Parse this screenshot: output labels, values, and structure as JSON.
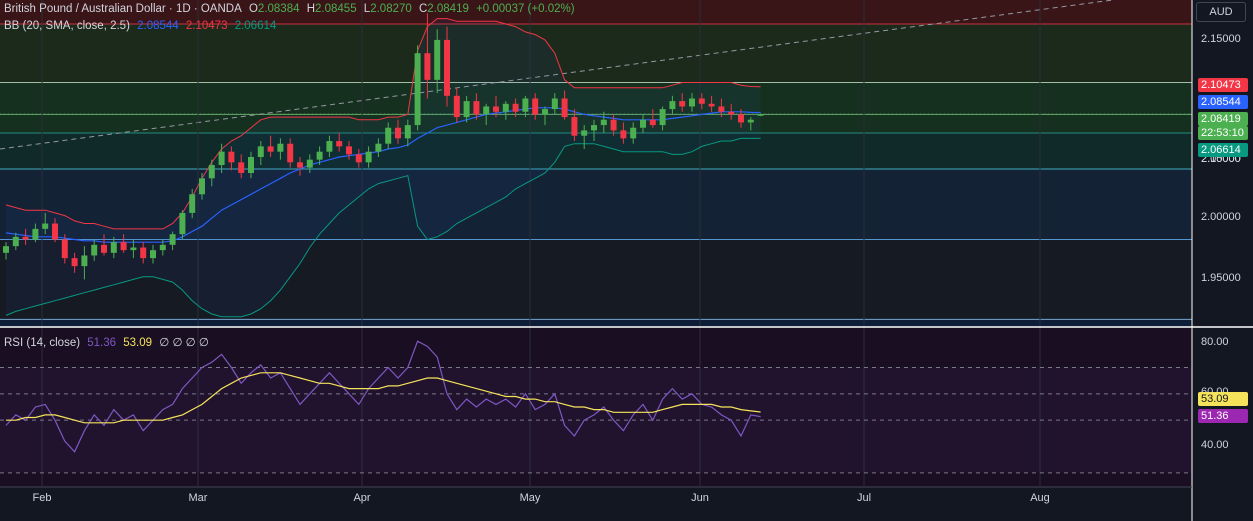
{
  "header": {
    "symbol": "British Pound / Australian Dollar · 1D · OANDA",
    "o_label": "O",
    "o": "2.08384",
    "h_label": "H",
    "h": "2.08455",
    "l_label": "L",
    "l": "2.08270",
    "c_label": "C",
    "c": "2.08419",
    "change": "+0.00037 (+0.02%)",
    "currency": "AUD"
  },
  "bb_legend": {
    "label": "BB (20, SMA, close, 2.5)",
    "basis": "2.08544",
    "upper": "2.10473",
    "lower": "2.06614"
  },
  "rsi_legend": {
    "label": "RSI (14, close)",
    "rsi": "51.36",
    "ma": "53.09",
    "extra": "∅ ∅ ∅ ∅"
  },
  "price_axis": [
    "2.15000",
    "2.10000",
    "2.05000",
    "2.00000",
    "1.95000"
  ],
  "rsi_axis": [
    "80.00",
    "60.00",
    "40.00"
  ],
  "tags": {
    "upper": "2.10473",
    "basis": "2.08544",
    "close": "2.08419",
    "countdown": "22:53:10",
    "lower": "2.06614",
    "rsi_ma": "53.09",
    "rsi": "51.36"
  },
  "months": [
    "Feb",
    "Mar",
    "Apr",
    "May",
    "Jun",
    "Jul",
    "Aug"
  ],
  "colors": {
    "up": "#4caf50",
    "down": "#f23645",
    "upper_band": "#f23645",
    "basis": "#2962ff",
    "lower_band": "#089981",
    "rsi": "#7e57c2",
    "rsi_ma": "#f5e35b",
    "close_tag": "#4caf50"
  },
  "chart_data": {
    "type": "candlestick",
    "price_ylim": [
      1.925,
      2.17
    ],
    "rsi_ylim": [
      25,
      85
    ],
    "candles": [
      [
        1.98,
        1.988,
        1.975,
        1.985
      ],
      [
        1.985,
        1.995,
        1.982,
        1.992
      ],
      [
        1.992,
        1.998,
        1.986,
        1.99
      ],
      [
        1.99,
        2.002,
        1.988,
        1.998
      ],
      [
        1.998,
        2.01,
        1.994,
        2.002
      ],
      [
        2.002,
        2.006,
        1.988,
        1.99
      ],
      [
        1.99,
        1.994,
        1.972,
        1.976
      ],
      [
        1.976,
        1.98,
        1.965,
        1.97
      ],
      [
        1.97,
        1.985,
        1.96,
        1.978
      ],
      [
        1.978,
        1.99,
        1.974,
        1.986
      ],
      [
        1.986,
        1.994,
        1.978,
        1.98
      ],
      [
        1.98,
        1.992,
        1.976,
        1.988
      ],
      [
        1.988,
        1.994,
        1.98,
        1.982
      ],
      [
        1.982,
        1.99,
        1.976,
        1.984
      ],
      [
        1.984,
        1.988,
        1.972,
        1.976
      ],
      [
        1.976,
        1.986,
        1.972,
        1.982
      ],
      [
        1.982,
        1.99,
        1.978,
        1.986
      ],
      [
        1.986,
        1.996,
        1.982,
        1.994
      ],
      [
        1.994,
        2.012,
        1.99,
        2.01
      ],
      [
        2.01,
        2.028,
        2.006,
        2.024
      ],
      [
        2.024,
        2.04,
        2.02,
        2.036
      ],
      [
        2.036,
        2.05,
        2.03,
        2.046
      ],
      [
        2.046,
        2.062,
        2.04,
        2.056
      ],
      [
        2.056,
        2.06,
        2.042,
        2.048
      ],
      [
        2.048,
        2.054,
        2.036,
        2.04
      ],
      [
        2.04,
        2.056,
        2.036,
        2.052
      ],
      [
        2.052,
        2.064,
        2.046,
        2.06
      ],
      [
        2.06,
        2.068,
        2.052,
        2.056
      ],
      [
        2.056,
        2.066,
        2.05,
        2.062
      ],
      [
        2.062,
        2.066,
        2.044,
        2.048
      ],
      [
        2.048,
        2.052,
        2.038,
        2.044
      ],
      [
        2.044,
        2.054,
        2.04,
        2.05
      ],
      [
        2.05,
        2.06,
        2.046,
        2.056
      ],
      [
        2.056,
        2.068,
        2.052,
        2.064
      ],
      [
        2.064,
        2.07,
        2.056,
        2.06
      ],
      [
        2.06,
        2.064,
        2.05,
        2.054
      ],
      [
        2.054,
        2.058,
        2.044,
        2.048
      ],
      [
        2.048,
        2.06,
        2.044,
        2.056
      ],
      [
        2.056,
        2.066,
        2.052,
        2.062
      ],
      [
        2.062,
        2.078,
        2.058,
        2.074
      ],
      [
        2.074,
        2.08,
        2.062,
        2.066
      ],
      [
        2.066,
        2.08,
        2.06,
        2.076
      ],
      [
        2.076,
        2.136,
        2.072,
        2.13
      ],
      [
        2.13,
        2.16,
        2.096,
        2.11
      ],
      [
        2.11,
        2.148,
        2.1,
        2.14
      ],
      [
        2.14,
        2.15,
        2.09,
        2.098
      ],
      [
        2.098,
        2.104,
        2.078,
        2.082
      ],
      [
        2.082,
        2.098,
        2.078,
        2.094
      ],
      [
        2.094,
        2.1,
        2.08,
        2.084
      ],
      [
        2.084,
        2.092,
        2.076,
        2.09
      ],
      [
        2.09,
        2.098,
        2.082,
        2.086
      ],
      [
        2.086,
        2.094,
        2.08,
        2.092
      ],
      [
        2.092,
        2.096,
        2.082,
        2.086
      ],
      [
        2.086,
        2.098,
        2.082,
        2.096
      ],
      [
        2.096,
        2.1,
        2.08,
        2.084
      ],
      [
        2.084,
        2.09,
        2.076,
        2.088
      ],
      [
        2.088,
        2.1,
        2.084,
        2.096
      ],
      [
        2.096,
        2.102,
        2.08,
        2.082
      ],
      [
        2.082,
        2.088,
        2.064,
        2.068
      ],
      [
        2.068,
        2.076,
        2.058,
        2.072
      ],
      [
        2.072,
        2.08,
        2.064,
        2.076
      ],
      [
        2.076,
        2.086,
        2.07,
        2.08
      ],
      [
        2.08,
        2.084,
        2.068,
        2.072
      ],
      [
        2.072,
        2.078,
        2.062,
        2.066
      ],
      [
        2.066,
        2.078,
        2.062,
        2.074
      ],
      [
        2.074,
        2.084,
        2.07,
        2.08
      ],
      [
        2.08,
        2.088,
        2.074,
        2.076
      ],
      [
        2.076,
        2.09,
        2.072,
        2.088
      ],
      [
        2.088,
        2.098,
        2.084,
        2.094
      ],
      [
        2.094,
        2.1,
        2.086,
        2.09
      ],
      [
        2.09,
        2.1,
        2.086,
        2.096
      ],
      [
        2.096,
        2.1,
        2.088,
        2.092
      ],
      [
        2.092,
        2.098,
        2.086,
        2.09
      ],
      [
        2.09,
        2.096,
        2.082,
        2.086
      ],
      [
        2.086,
        2.092,
        2.08,
        2.084
      ],
      [
        2.084,
        2.088,
        2.074,
        2.078
      ],
      [
        2.078,
        2.082,
        2.072,
        2.08
      ],
      [
        2.083,
        2.08455,
        2.0827,
        2.08419
      ]
    ],
    "bb_upper": [
      2.016,
      2.014,
      2.012,
      2.012,
      2.012,
      2.01,
      2.008,
      2.004,
      2.002,
      2.002,
      2.0,
      1.998,
      1.998,
      1.998,
      1.998,
      1.998,
      1.998,
      2.002,
      2.01,
      2.022,
      2.036,
      2.048,
      2.058,
      2.064,
      2.068,
      2.074,
      2.08,
      2.082,
      2.082,
      2.082,
      2.082,
      2.082,
      2.082,
      2.082,
      2.082,
      2.082,
      2.08,
      2.08,
      2.08,
      2.082,
      2.082,
      2.084,
      2.132,
      2.15,
      2.156,
      2.156,
      2.154,
      2.154,
      2.154,
      2.154,
      2.154,
      2.152,
      2.15,
      2.146,
      2.144,
      2.14,
      2.13,
      2.11,
      2.104,
      2.104,
      2.104,
      2.104,
      2.104,
      2.104,
      2.104,
      2.104,
      2.104,
      2.104,
      2.106,
      2.108,
      2.108,
      2.108,
      2.108,
      2.108,
      2.108,
      2.106,
      2.105,
      2.10473
    ],
    "bb_basis": [
      1.995,
      1.994,
      1.993,
      1.992,
      1.992,
      1.992,
      1.991,
      1.99,
      1.989,
      1.989,
      1.988,
      1.988,
      1.988,
      1.988,
      1.988,
      1.988,
      1.988,
      1.989,
      1.992,
      1.996,
      2.0,
      2.006,
      2.012,
      2.016,
      2.02,
      2.024,
      2.028,
      2.032,
      2.036,
      2.04,
      2.043,
      2.046,
      2.048,
      2.05,
      2.052,
      2.053,
      2.054,
      2.055,
      2.056,
      2.058,
      2.059,
      2.061,
      2.066,
      2.07,
      2.074,
      2.076,
      2.078,
      2.08,
      2.082,
      2.084,
      2.085,
      2.086,
      2.087,
      2.088,
      2.089,
      2.089,
      2.089,
      2.088,
      2.086,
      2.084,
      2.083,
      2.082,
      2.081,
      2.08,
      2.08,
      2.08,
      2.08,
      2.08,
      2.081,
      2.082,
      2.083,
      2.084,
      2.085,
      2.086,
      2.086,
      2.086,
      2.0855,
      2.08544
    ],
    "bb_lower": [
      1.933,
      1.936,
      1.938,
      1.94,
      1.942,
      1.944,
      1.946,
      1.948,
      1.95,
      1.952,
      1.954,
      1.956,
      1.958,
      1.96,
      1.962,
      1.962,
      1.96,
      1.958,
      1.952,
      1.944,
      1.938,
      1.934,
      1.932,
      1.932,
      1.932,
      1.934,
      1.938,
      1.944,
      1.952,
      1.962,
      1.972,
      1.984,
      1.994,
      2.002,
      2.01,
      2.016,
      2.022,
      2.028,
      2.032,
      2.034,
      2.036,
      2.038,
      2.0,
      1.99,
      1.992,
      1.996,
      2.002,
      2.006,
      2.01,
      2.014,
      2.018,
      2.022,
      2.028,
      2.032,
      2.036,
      2.04,
      2.048,
      2.06,
      2.062,
      2.062,
      2.062,
      2.06,
      2.058,
      2.056,
      2.056,
      2.056,
      2.056,
      2.056,
      2.054,
      2.054,
      2.056,
      2.06,
      2.062,
      2.064,
      2.064,
      2.066,
      2.066,
      2.06614
    ],
    "rsi": [
      48,
      52,
      50,
      55,
      56,
      50,
      42,
      38,
      46,
      52,
      48,
      54,
      50,
      52,
      46,
      50,
      54,
      56,
      62,
      66,
      70,
      72,
      75,
      70,
      64,
      68,
      71,
      66,
      68,
      62,
      56,
      60,
      64,
      68,
      64,
      60,
      56,
      62,
      66,
      70,
      66,
      70,
      80,
      78,
      74,
      60,
      54,
      58,
      55,
      58,
      56,
      58,
      55,
      60,
      54,
      56,
      60,
      48,
      44,
      50,
      52,
      55,
      50,
      46,
      52,
      56,
      50,
      58,
      62,
      58,
      60,
      56,
      55,
      52,
      50,
      44,
      52,
      51.36
    ],
    "rsi_ma": [
      50,
      50,
      51,
      51,
      52,
      52,
      51,
      50,
      49,
      49,
      49,
      49,
      50,
      50,
      50,
      50,
      50,
      51,
      52,
      54,
      56,
      59,
      62,
      64,
      66,
      67,
      68,
      68,
      68,
      67,
      66,
      65,
      64,
      64,
      63,
      62,
      62,
      62,
      62,
      63,
      63,
      64,
      65,
      66,
      66,
      65,
      64,
      63,
      62,
      61,
      60,
      59,
      59,
      58,
      58,
      57,
      57,
      56,
      55,
      55,
      54,
      54,
      53,
      53,
      53,
      53,
      53,
      54,
      55,
      56,
      56,
      56,
      56,
      55,
      55,
      54,
      53.5,
      53.09
    ],
    "h_levels": [
      2.152,
      2.108,
      2.084,
      2.07,
      2.043,
      1.99,
      1.93
    ],
    "rsi_levels": [
      70,
      60,
      50,
      30
    ]
  }
}
